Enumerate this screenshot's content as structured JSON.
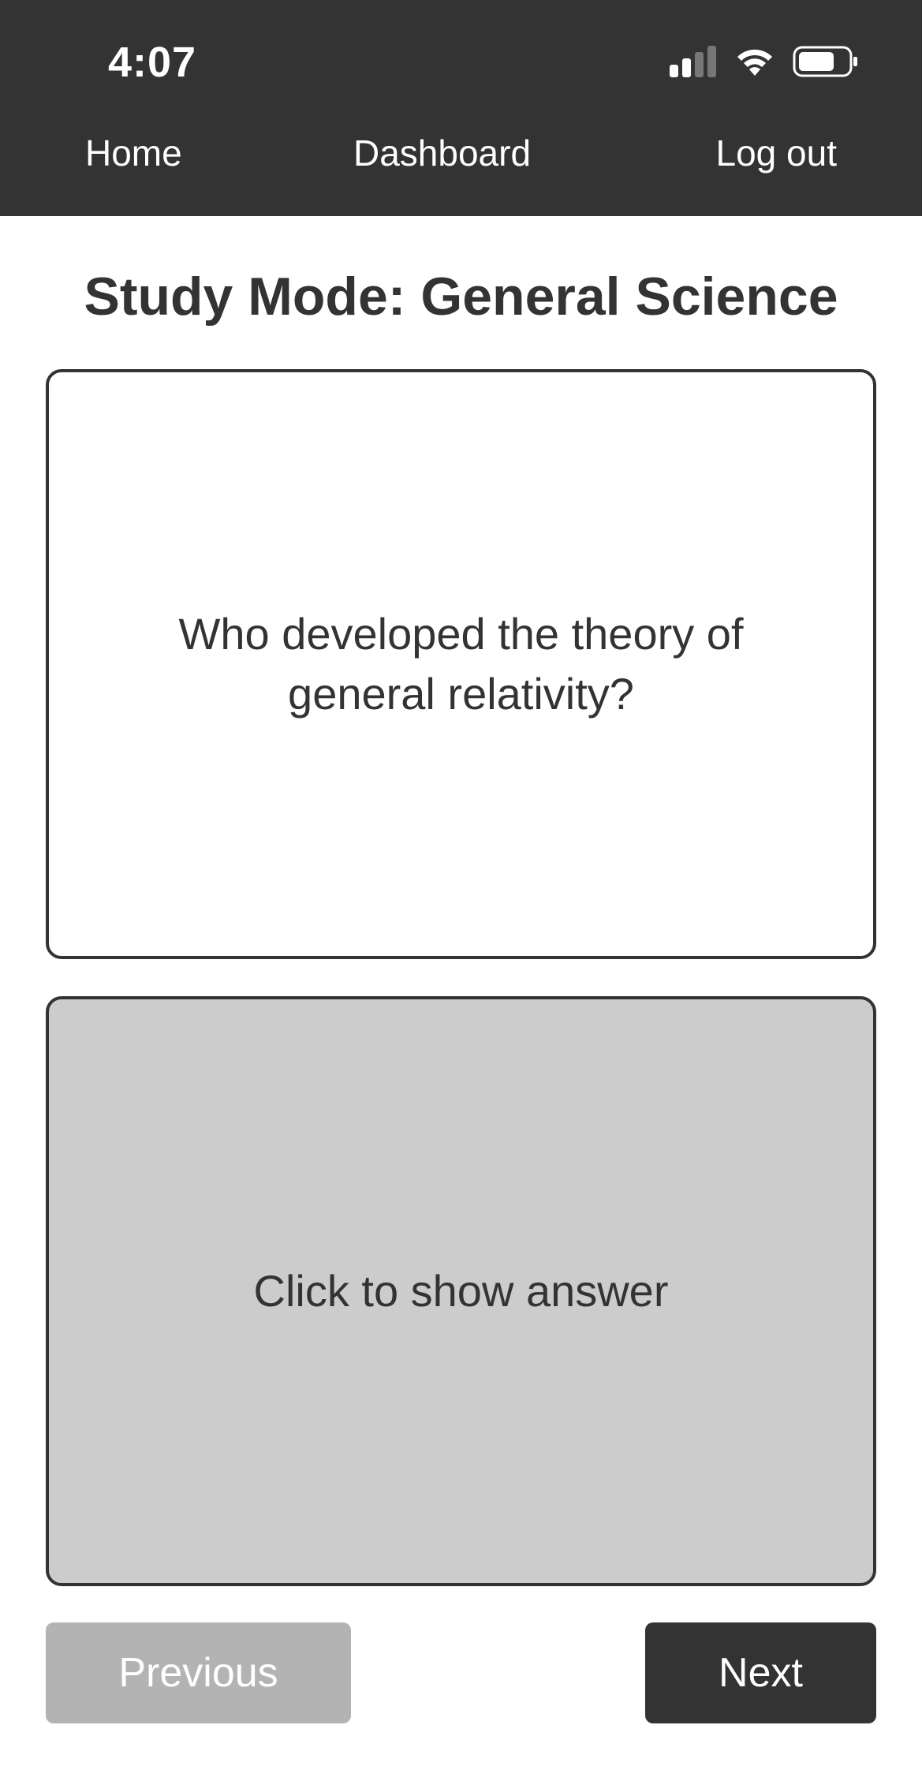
{
  "status_bar": {
    "time": "4:07",
    "icons": [
      "cellular-signal-icon",
      "wifi-icon",
      "battery-icon"
    ]
  },
  "nav": {
    "home": "Home",
    "dashboard": "Dashboard",
    "logout": "Log out"
  },
  "page": {
    "title": "Study Mode: General Science"
  },
  "flashcard": {
    "question": "Who developed the theory of general relativity?",
    "answer_prompt": "Click to show answer"
  },
  "controls": {
    "previous_label": "Previous",
    "next_label": "Next"
  },
  "colors": {
    "header_bg": "#333333",
    "answer_bg": "#cccccc",
    "previous_bg": "#b3b3b3",
    "next_bg": "#333333"
  }
}
